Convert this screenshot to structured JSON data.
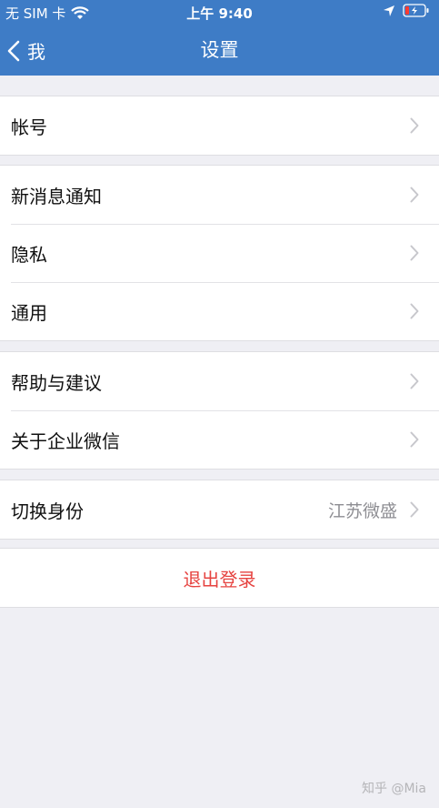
{
  "status_bar": {
    "carrier": "无 SIM 卡",
    "time": "上午 9:40"
  },
  "nav": {
    "back_label": "我",
    "title": "设置"
  },
  "groups": [
    {
      "items": [
        {
          "label": "帐号"
        }
      ]
    },
    {
      "items": [
        {
          "label": "新消息通知"
        },
        {
          "label": "隐私"
        },
        {
          "label": "通用"
        }
      ]
    },
    {
      "items": [
        {
          "label": "帮助与建议"
        },
        {
          "label": "关于企业微信"
        }
      ]
    },
    {
      "items": [
        {
          "label": "切换身份",
          "value": "江苏微盛"
        }
      ]
    }
  ],
  "logout": {
    "label": "退出登录",
    "color": "#e64340"
  },
  "watermark": "知乎 @Mia",
  "colors": {
    "nav_bg": "#3e7cc6",
    "page_bg": "#efeff4"
  }
}
